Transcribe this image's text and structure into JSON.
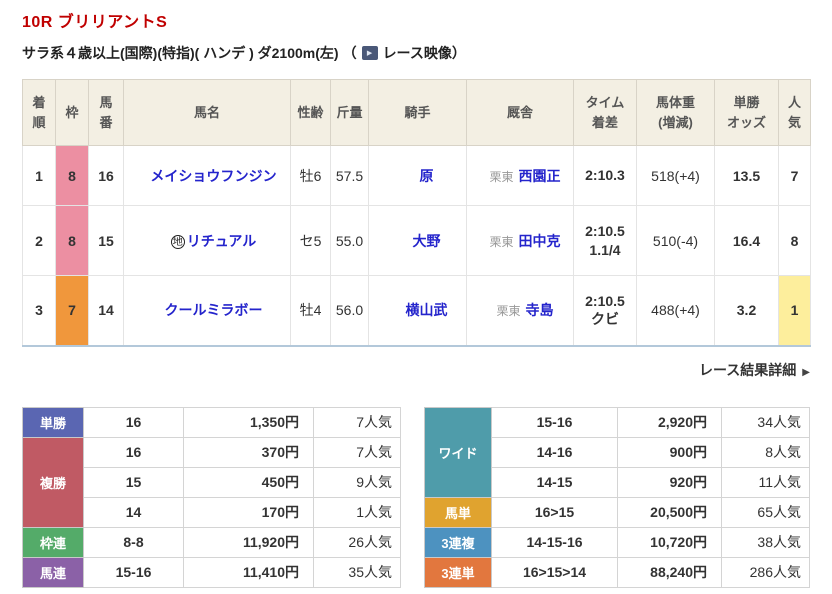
{
  "colors": {
    "title_red": "#c00000",
    "link_blue": "#2424cc",
    "header_beige": "#f3efe3",
    "waku_8_pink": "#ec8fa2",
    "waku_7_orange": "#f0973c",
    "ninki_first_yellow": "#fdee9c"
  },
  "header": {
    "race_title": "10R ブリリアントS",
    "race_conditions": "サラ系４歳以上(国際)(特指)( ハンデ ) ダ2100m(左)",
    "paren_open": "（",
    "video_label": "レース映像",
    "paren_close": "）",
    "video_icon_glyph": "▶"
  },
  "results_table": {
    "headers": [
      "着\n順",
      "枠",
      "馬\n番",
      "馬名",
      "性齢",
      "斤量",
      "騎手",
      "厩舎",
      "タイム\n着差",
      "馬体重\n(増減)",
      "単勝\nオッズ",
      "人\n気"
    ],
    "rows": [
      {
        "rank": "1",
        "waku": "8",
        "waku_bg": "#ec8fa2",
        "horse_no": "16",
        "mark": "",
        "horse_name": "メイショウフンジン",
        "sex_age": "牡6",
        "weight": "57.5",
        "jockey": "原",
        "stable_area": "栗東",
        "trainer": "西園正",
        "time": "2:10.3",
        "margin": "",
        "body_weight": "518(+4)",
        "odds": "13.5",
        "ninki": "7",
        "ninki_first": false
      },
      {
        "rank": "2",
        "waku": "8",
        "waku_bg": "#ec8fa2",
        "horse_no": "15",
        "mark": "地",
        "horse_name": "リチュアル",
        "sex_age": "セ5",
        "weight": "55.0",
        "jockey": "大野",
        "stable_area": "栗東",
        "trainer": "田中克",
        "time": "2:10.5",
        "margin": "1.1/4",
        "body_weight": "510(-4)",
        "odds": "16.4",
        "ninki": "8",
        "ninki_first": false
      },
      {
        "rank": "3",
        "waku": "7",
        "waku_bg": "#f0973c",
        "horse_no": "14",
        "mark": "",
        "horse_name": "クールミラボー",
        "sex_age": "牡4",
        "weight": "56.0",
        "jockey": "横山武",
        "stable_area": "栗東",
        "trainer": "寺島",
        "time": "2:10.5",
        "margin": "クビ",
        "body_weight": "488(+4)",
        "odds": "3.2",
        "ninki": "1",
        "ninki_first": true
      }
    ]
  },
  "detail_link": {
    "label": "レース結果詳細",
    "arrow": "▶"
  },
  "payout_tables": {
    "left": [
      {
        "type": "単勝",
        "color": "#5a66b2",
        "rows": [
          [
            "16",
            "1,350円",
            "7人気"
          ]
        ]
      },
      {
        "type": "複勝",
        "color": "#c05a64",
        "rows": [
          [
            "16",
            "370円",
            "7人気"
          ],
          [
            "15",
            "450円",
            "9人気"
          ],
          [
            "14",
            "170円",
            "1人気"
          ]
        ]
      },
      {
        "type": "枠連",
        "color": "#54ab69",
        "rows": [
          [
            "8-8",
            "11,920円",
            "26人気"
          ]
        ]
      },
      {
        "type": "馬連",
        "color": "#8b61a7",
        "rows": [
          [
            "15-16",
            "11,410円",
            "35人気"
          ]
        ]
      }
    ],
    "right": [
      {
        "type": "ワイド",
        "color": "#4f9caa",
        "rows": [
          [
            "15-16",
            "2,920円",
            "34人気"
          ],
          [
            "14-16",
            "900円",
            "8人気"
          ],
          [
            "14-15",
            "920円",
            "11人気"
          ]
        ]
      },
      {
        "type": "馬単",
        "color": "#e0a32f",
        "rows": [
          [
            "16>15",
            "20,500円",
            "65人気"
          ]
        ]
      },
      {
        "type": "3連複",
        "color": "#4d92c0",
        "rows": [
          [
            "14-15-16",
            "10,720円",
            "38人気"
          ]
        ]
      },
      {
        "type": "3連単",
        "color": "#e2773e",
        "rows": [
          [
            "16>15>14",
            "88,240円",
            "286人気"
          ]
        ]
      }
    ]
  }
}
